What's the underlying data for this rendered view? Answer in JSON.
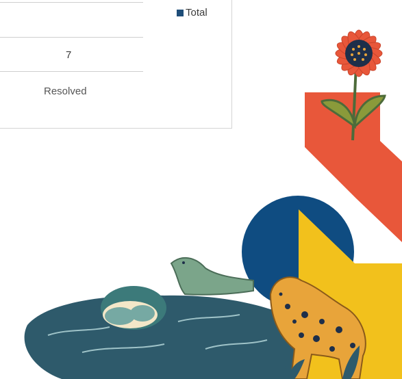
{
  "chart_data": {
    "type": "bar",
    "categories": [
      "Resolved"
    ],
    "series": [
      {
        "name": "Total",
        "values": [
          7
        ]
      }
    ],
    "data_labels": [
      "7"
    ],
    "legend_position": "top-right",
    "colors": {
      "total": "#1f4e79"
    }
  },
  "legend": {
    "label": "Total",
    "color": "#1f4e79"
  },
  "category_label": "Resolved",
  "value_label": "7",
  "decor": {
    "flower_color": "#e8573a",
    "flower_center": "#1e2f4a",
    "blue_color": "#0f4c81",
    "yellow_color": "#f2c11c",
    "water_color": "#2e5a6b",
    "alligator_color": "#7ba58a",
    "leopard_color": "#e8a43a"
  }
}
